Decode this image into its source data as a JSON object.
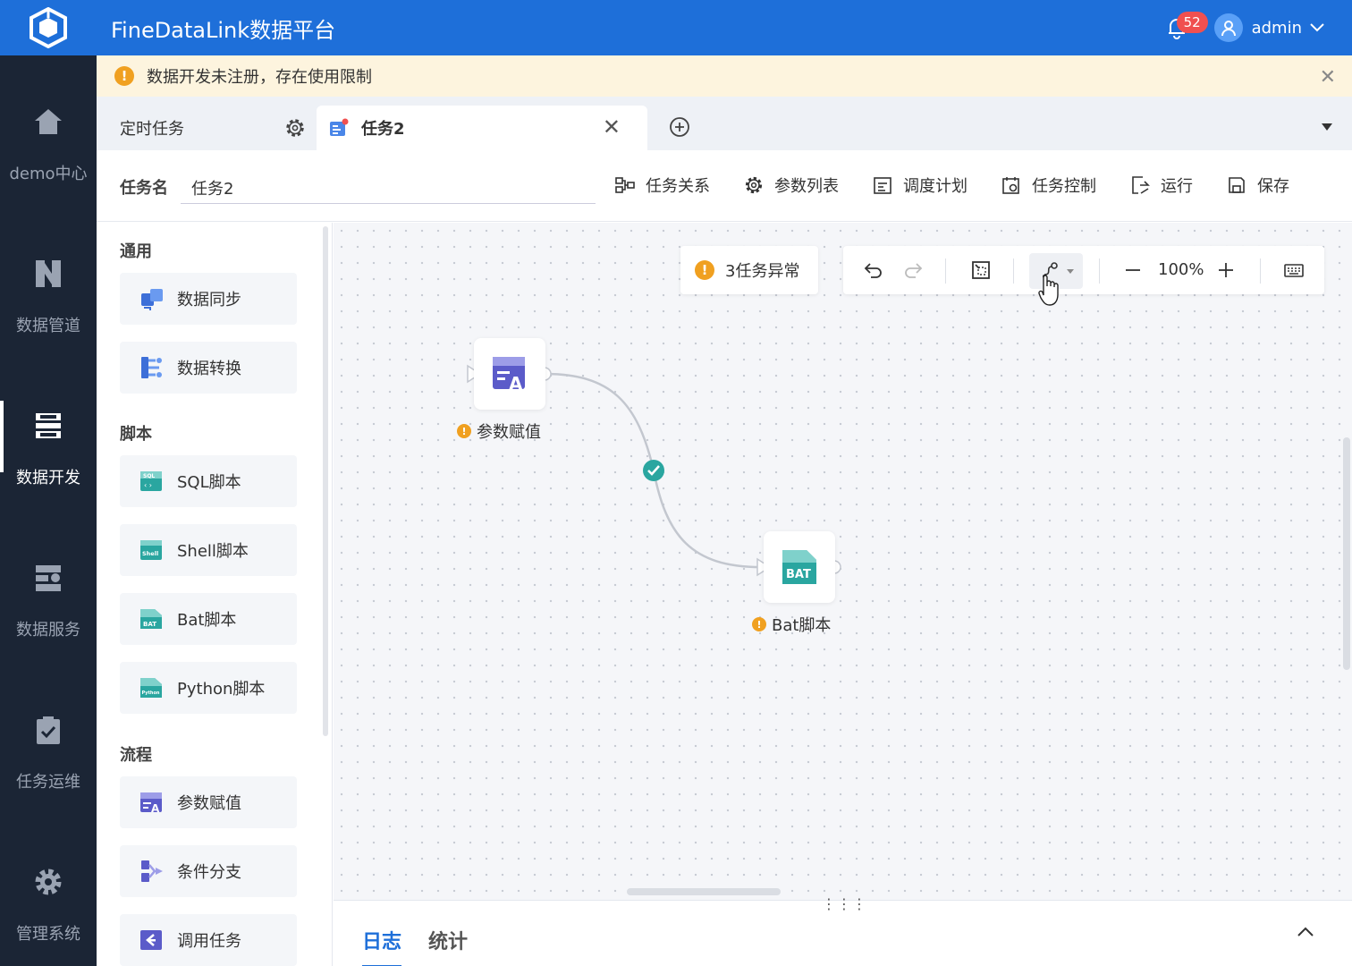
{
  "app": {
    "title": "FineDataLink数据平台"
  },
  "header": {
    "notification_count": "52",
    "user": "admin"
  },
  "nav": {
    "items": [
      {
        "label": "demo中心",
        "icon": "home-icon"
      },
      {
        "label": "数据管道",
        "icon": "pipeline-icon"
      },
      {
        "label": "数据开发",
        "icon": "dev-icon",
        "active": true
      },
      {
        "label": "数据服务",
        "icon": "service-icon"
      },
      {
        "label": "任务运维",
        "icon": "ops-icon"
      },
      {
        "label": "管理系统",
        "icon": "settings-icon"
      }
    ]
  },
  "notice": {
    "text": "数据开发未注册，存在使用限制"
  },
  "tabs": [
    {
      "label": "定时任务"
    },
    {
      "label": "任务2",
      "active": true
    }
  ],
  "toolbar": {
    "name_label": "任务名",
    "name_value": "任务2",
    "actions": [
      "任务关系",
      "参数列表",
      "调度计划",
      "任务控制",
      "运行",
      "保存"
    ]
  },
  "palette": {
    "sections": [
      {
        "title": "通用",
        "items": [
          "数据同步",
          "数据转换"
        ]
      },
      {
        "title": "脚本",
        "items": [
          "SQL脚本",
          "Shell脚本",
          "Bat脚本",
          "Python脚本"
        ]
      },
      {
        "title": "流程",
        "items": [
          "参数赋值",
          "条件分支",
          "调用任务"
        ]
      }
    ]
  },
  "canvas": {
    "error_text": "3任务异常",
    "zoom": "100%",
    "nodes": [
      {
        "label": "参数赋值",
        "icon": "param-assign-icon"
      },
      {
        "label": "Bat脚本",
        "icon": "bat-script-icon",
        "icon_text": "BAT"
      }
    ]
  },
  "bottom": {
    "tabs": [
      "日志",
      "统计"
    ]
  },
  "colors": {
    "primary": "#1e6fd9",
    "nav_bg": "#1b2535",
    "warning": "#f0a020",
    "success": "#2aa6a0",
    "notice_bg": "#fdf4de"
  }
}
